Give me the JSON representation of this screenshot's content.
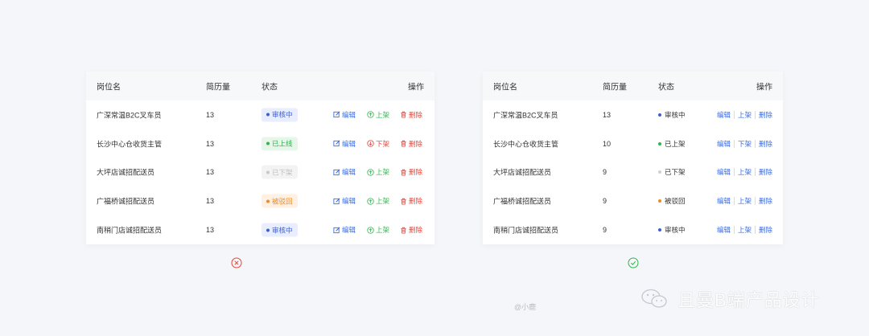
{
  "columns": [
    "岗位名",
    "简历量",
    "状态",
    "操作"
  ],
  "rows": [
    {
      "name": "广深常温B2C叉车员",
      "count": "13",
      "status": "审核中"
    },
    {
      "name": "长沙中心仓收货主管",
      "count": "13",
      "status": "已上线"
    },
    {
      "name": "大坪店诚招配送员",
      "count": "13",
      "status": "已下架"
    },
    {
      "name": "广福桥诚招配送员",
      "count": "13",
      "status": "被驳回"
    },
    {
      "name": "南稍门店诚招配送员",
      "count": "13",
      "status": "审核中"
    }
  ],
  "rows_right": [
    {
      "name": "广深常温B2C叉车员",
      "count": "13",
      "status": "审核中",
      "toggle": "上架"
    },
    {
      "name": "长沙中心仓收货主管",
      "count": "10",
      "status": "已上架",
      "toggle": "下架"
    },
    {
      "name": "大坪店诚招配送员",
      "count": "9",
      "status": "已下架",
      "toggle": "上架"
    },
    {
      "name": "广福桥诚招配送员",
      "count": "9",
      "status": "被驳回",
      "toggle": "上架"
    },
    {
      "name": "南稍门店诚招配送员",
      "count": "9",
      "status": "审核中",
      "toggle": "上架"
    }
  ],
  "actions": {
    "edit": "编辑",
    "list": "上架",
    "unlist": "下架",
    "delete": "删除"
  },
  "left_toggles": [
    "上架",
    "下架",
    "上架",
    "上架",
    "上架"
  ],
  "verdict": {
    "left_icon": "wrong-icon",
    "right_icon": "correct-icon",
    "left_color": "#e8443a",
    "right_color": "#2fb54a"
  },
  "watermark": {
    "author": "@小鹿",
    "brand": "且曼B端产品设计"
  },
  "colors": {
    "blue": "#3a6ce0",
    "green": "#35b651",
    "red": "#e8443a",
    "orange": "#f08a24",
    "gray": "#c0c0c0"
  }
}
